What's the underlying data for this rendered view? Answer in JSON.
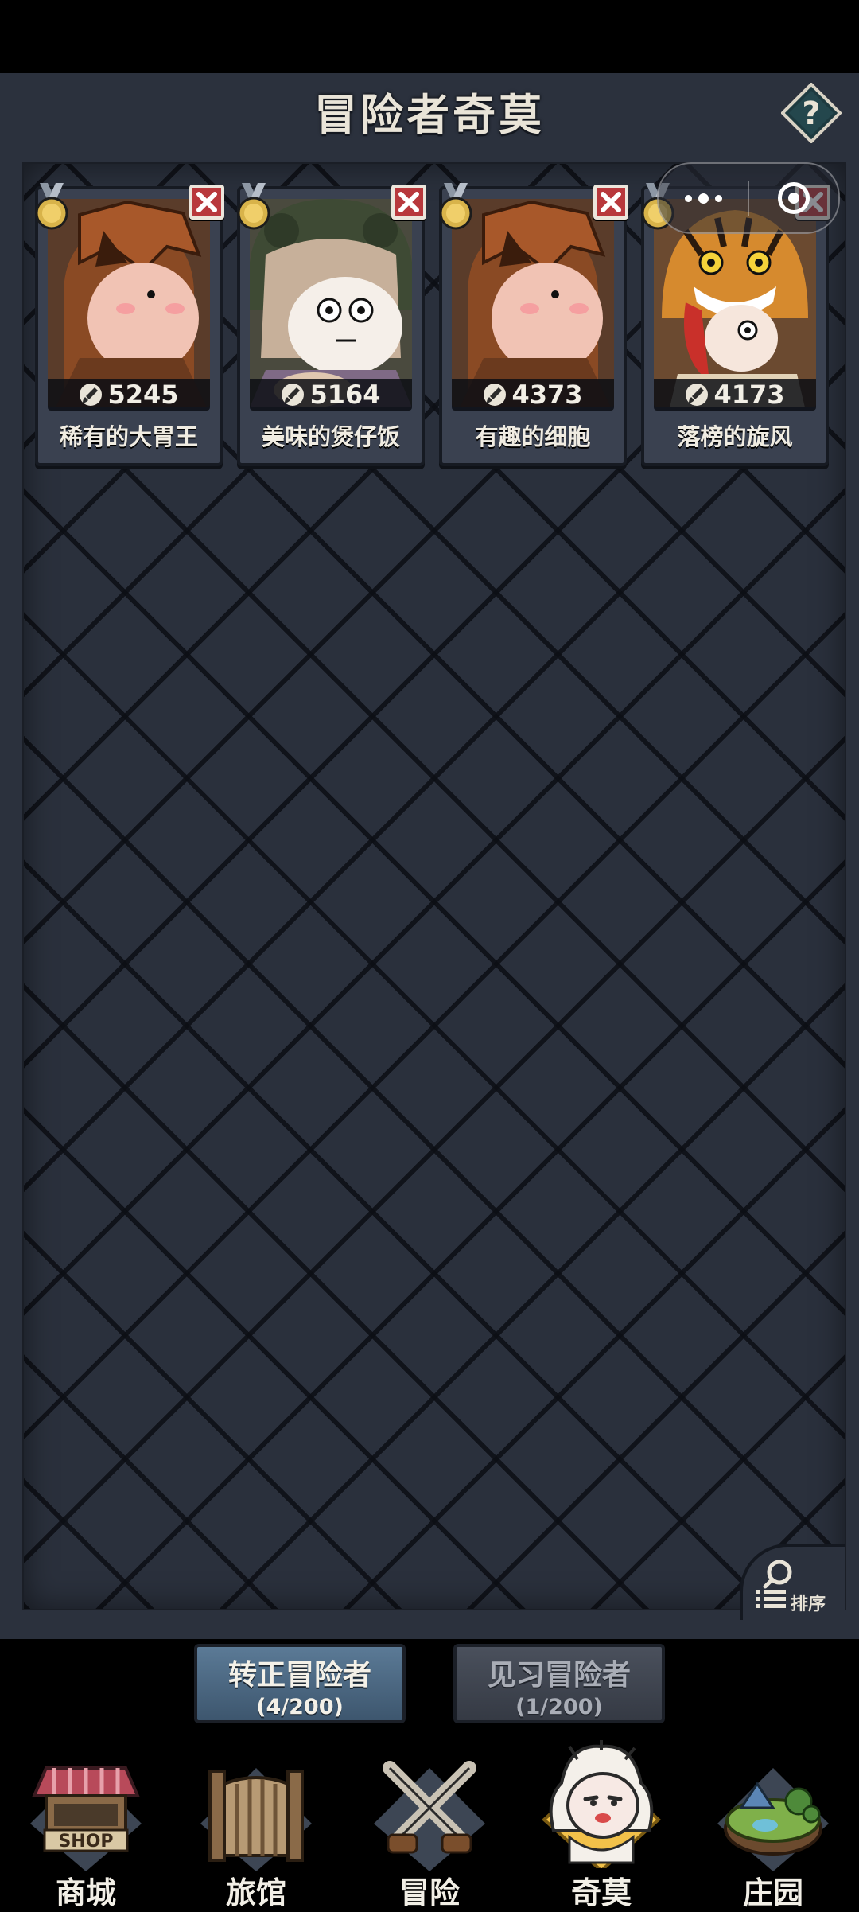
{
  "header": {
    "title": "冒险者奇莫",
    "help_symbol": "?"
  },
  "cards": [
    {
      "name": "稀有的大胃王",
      "score": "5245",
      "portrait": "pumpkin-hood-chimo-portrait"
    },
    {
      "name": "美味的煲仔饭",
      "score": "5164",
      "portrait": "frog-hood-girl-chimo-portrait"
    },
    {
      "name": "有趣的细胞",
      "score": "4373",
      "portrait": "pumpkin-hood-chimo-portrait"
    },
    {
      "name": "落榜的旋风",
      "score": "4173",
      "portrait": "tiger-hood-chimo-portrait"
    }
  ],
  "sort": {
    "label": "排序"
  },
  "tabs": [
    {
      "label": "转正冒险者",
      "count": "(4/200)",
      "active": true
    },
    {
      "label": "见习冒险者",
      "count": "(1/200)",
      "active": false
    }
  ],
  "nav": [
    {
      "label": "商城",
      "icon": "shop-icon",
      "sign": "SHOP"
    },
    {
      "label": "旅馆",
      "icon": "inn-gate-icon"
    },
    {
      "label": "冒险",
      "icon": "crossed-swords-icon"
    },
    {
      "label": "奇莫",
      "icon": "chimo-character-icon",
      "active": true
    },
    {
      "label": "庄园",
      "icon": "manor-island-icon"
    }
  ],
  "colors": {
    "panel_bg": "#2b313d",
    "active_tab": "#4f6c88",
    "close_red": "#b8383c",
    "gold_medal": "#d8b34a",
    "active_nav": "#f2c14a"
  }
}
